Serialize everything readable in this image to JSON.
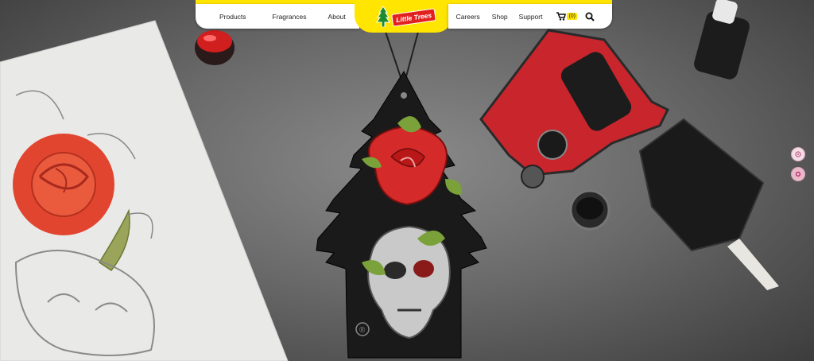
{
  "brand": {
    "logo_text": "Little Trees"
  },
  "nav": {
    "left": [
      "Products",
      "Fragrances",
      "About"
    ],
    "right": [
      "Careers",
      "Shop",
      "Support"
    ],
    "cart_count": "(0)"
  },
  "hero": {
    "tree_mark": "®"
  },
  "colors": {
    "nav_yellow": "#ffe500",
    "logo_red": "#e32020",
    "rose_red": "#d52a2a"
  },
  "icons": [
    "tree-logo-icon",
    "cart-icon",
    "search-icon",
    "side-flower-icon",
    "side-rose-icon"
  ]
}
